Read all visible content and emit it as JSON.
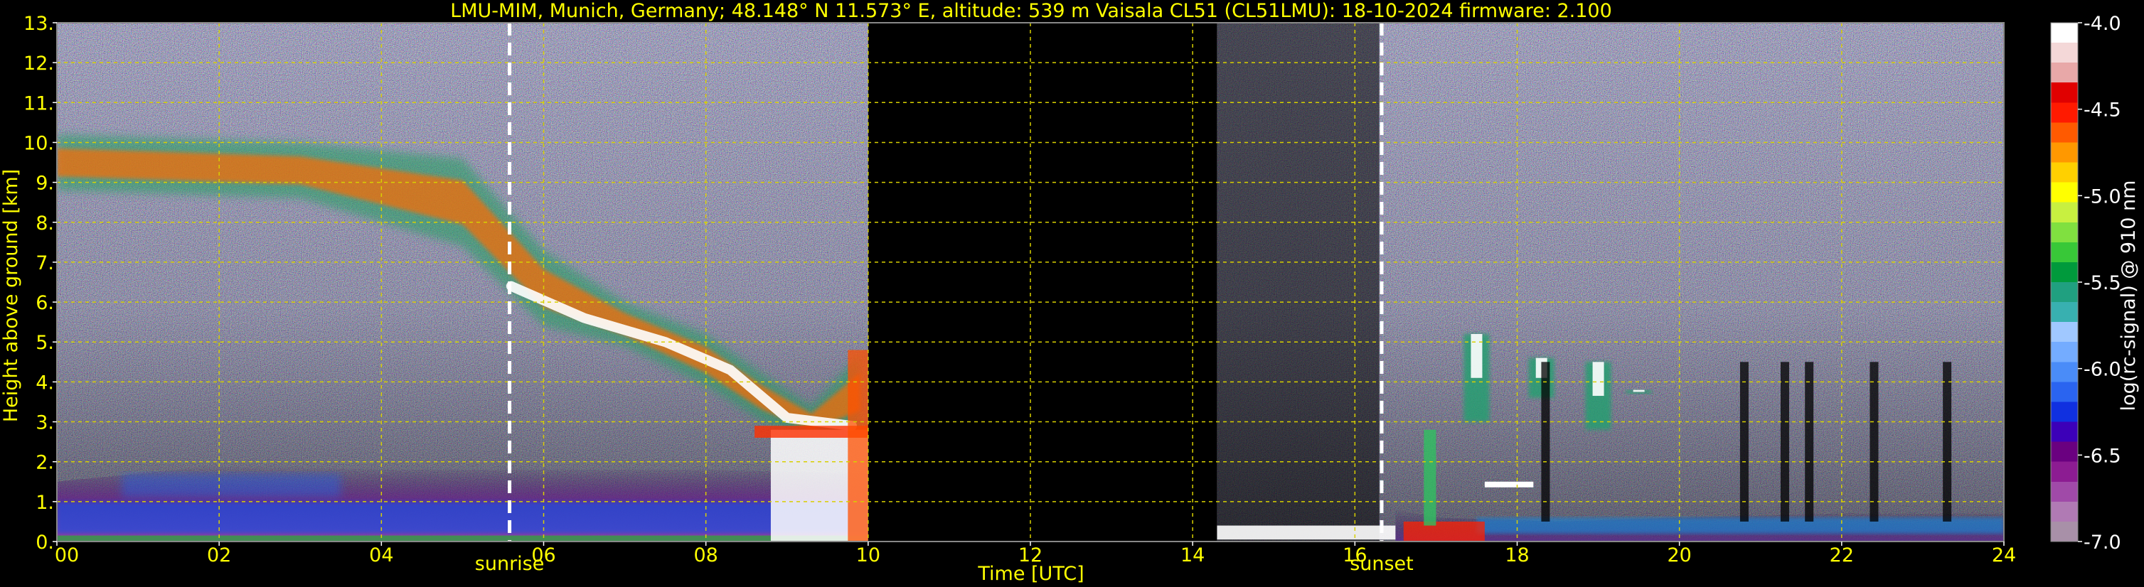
{
  "chart_data": {
    "type": "heatmap",
    "title": "LMU-MIM, Munich, Germany; 48.148° N 11.573° E, altitude: 539 m    Vaisala CL51 (CL51LMU): 18-10-2024    firmware: 2.100",
    "xlabel": "Time [UTC]",
    "ylabel": "Height above ground [km]",
    "xlim": [
      0,
      24
    ],
    "ylim": [
      0,
      13
    ],
    "x_ticks": [
      {
        "value": 0,
        "label": "00"
      },
      {
        "value": 2,
        "label": "02"
      },
      {
        "value": 4,
        "label": "04"
      },
      {
        "value": 6,
        "label": "06"
      },
      {
        "value": 8,
        "label": "08"
      },
      {
        "value": 10,
        "label": "10"
      },
      {
        "value": 12,
        "label": "12"
      },
      {
        "value": 14,
        "label": "14"
      },
      {
        "value": 16,
        "label": "16"
      },
      {
        "value": 18,
        "label": "18"
      },
      {
        "value": 20,
        "label": "20"
      },
      {
        "value": 22,
        "label": "22"
      },
      {
        "value": 24,
        "label": "24"
      }
    ],
    "y_ticks": [
      {
        "value": 0,
        "label": "0."
      },
      {
        "value": 1,
        "label": "1."
      },
      {
        "value": 2,
        "label": "2."
      },
      {
        "value": 3,
        "label": "3."
      },
      {
        "value": 4,
        "label": "4."
      },
      {
        "value": 5,
        "label": "5."
      },
      {
        "value": 6,
        "label": "6."
      },
      {
        "value": 7,
        "label": "7."
      },
      {
        "value": 8,
        "label": "8."
      },
      {
        "value": 9,
        "label": "9."
      },
      {
        "value": 10,
        "label": "10."
      },
      {
        "value": 11,
        "label": "11."
      },
      {
        "value": 12,
        "label": "12."
      },
      {
        "value": 13,
        "label": "13."
      }
    ],
    "grid": true,
    "markers": [
      {
        "x": 5.58,
        "label": "sunrise"
      },
      {
        "x": 16.33,
        "label": "sunset"
      }
    ],
    "data_gaps": [
      [
        10.0,
        14.3
      ]
    ],
    "colorbar": {
      "label": "log(rc-signal) @ 910 nm",
      "range": [
        -7.0,
        -4.0
      ],
      "ticks": [
        "-4.0",
        "-4.5",
        "-5.0",
        "-5.5",
        "-6.0",
        "-6.5",
        "-7.0"
      ],
      "colors": [
        "#a890a8",
        "#b07ab4",
        "#a04aa8",
        "#8c1c92",
        "#6a0080",
        "#3c00b8",
        "#1030e0",
        "#2a64f0",
        "#4a8cf8",
        "#74acff",
        "#a0c8ff",
        "#38b0b0",
        "#20a080",
        "#009a3c",
        "#38c838",
        "#80e040",
        "#c8f040",
        "#ffff00",
        "#ffd000",
        "#ff9800",
        "#ff5a00",
        "#ff1a00",
        "#e00000",
        "#e8a8a8",
        "#f4d8d8",
        "#ffffff"
      ]
    },
    "features": [
      {
        "name": "cirrus layer",
        "x": [
          0.0,
          3.0,
          5.0,
          6.0,
          7.0,
          8.0,
          8.7,
          9.3,
          9.9
        ],
        "y_top": [
          10.2,
          10.0,
          9.6,
          7.3,
          6.0,
          5.2,
          4.2,
          3.4,
          4.7
        ],
        "y_bottom": [
          8.8,
          8.6,
          7.4,
          5.4,
          4.9,
          3.9,
          3.0,
          2.6,
          2.8
        ]
      },
      {
        "name": "boundary layer",
        "x": [
          0.0,
          2.0,
          4.0,
          6.0,
          8.0,
          10.0
        ],
        "top": [
          1.5,
          1.9,
          1.8,
          1.8,
          1.8,
          1.7
        ]
      },
      {
        "name": "night cloud bands",
        "x": [
          17.5,
          18.3,
          19.0,
          19.5
        ],
        "y_top": [
          5.2,
          4.6,
          4.5,
          3.8
        ],
        "y_bottom": [
          3.0,
          3.6,
          2.8,
          3.7
        ]
      },
      {
        "name": "low cloud",
        "x": [
          16.5,
          17.0,
          18.5,
          20.0,
          22.0,
          24.0
        ],
        "top": [
          0.8,
          0.6,
          0.5,
          0.6,
          0.7,
          0.7
        ]
      }
    ]
  }
}
